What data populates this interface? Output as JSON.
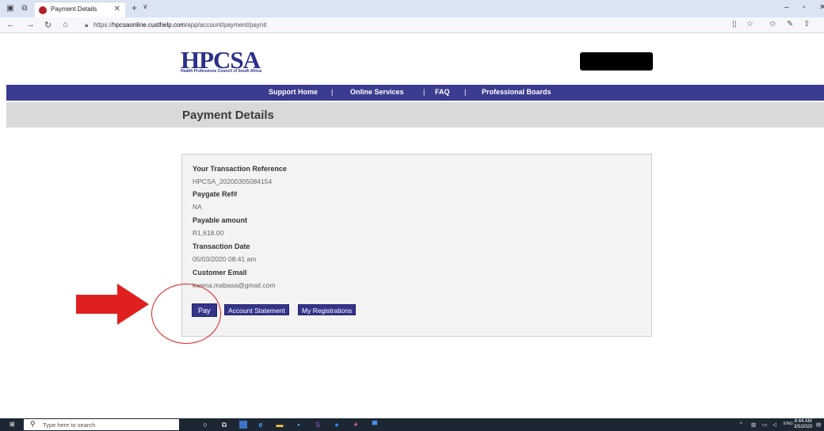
{
  "browser": {
    "tab_title": "Payment Details",
    "url_prefix": "https://",
    "url_host": "hpcsaonline.custhelp.com",
    "url_path": "/app/account/payment/paynit"
  },
  "site": {
    "logo_text": "HPCSA",
    "logo_tagline": "Health Professions Council of South Africa",
    "nav": [
      "Support Home",
      "Online Services",
      "FAQ",
      "Professional Boards"
    ],
    "nav_separator": "|",
    "page_title": "Payment Details"
  },
  "payment": {
    "fields": [
      {
        "label": "Your Transaction Reference",
        "value": "HPCSA_20200305084154"
      },
      {
        "label": "Paygate Ref#",
        "value": "NA"
      },
      {
        "label": "Payable amount",
        "value": "R1,618.00"
      },
      {
        "label": "Transaction Date",
        "value": "05/03/2020 08:41 am"
      },
      {
        "label": "Customer Email",
        "value": "kwena.mabasa@gmail.com"
      }
    ],
    "buttons": {
      "pay": "Pay",
      "statement": "Account Statement",
      "registrations": "My Registrations"
    }
  },
  "annotation_colors": {
    "arrow": "#e02020",
    "circle": "#e02020"
  },
  "taskbar": {
    "search_placeholder": "Type here to search",
    "language": "ENG",
    "time": "8:44 AM",
    "date": "3/5/2020"
  },
  "icons": [
    "back-icon",
    "forward-icon",
    "refresh-icon",
    "home-icon",
    "lock-icon",
    "favorites-icon",
    "reading-list-icon",
    "share-icon",
    "windows-start-icon",
    "search-icon",
    "edge-icon",
    "file-explorer-icon"
  ]
}
